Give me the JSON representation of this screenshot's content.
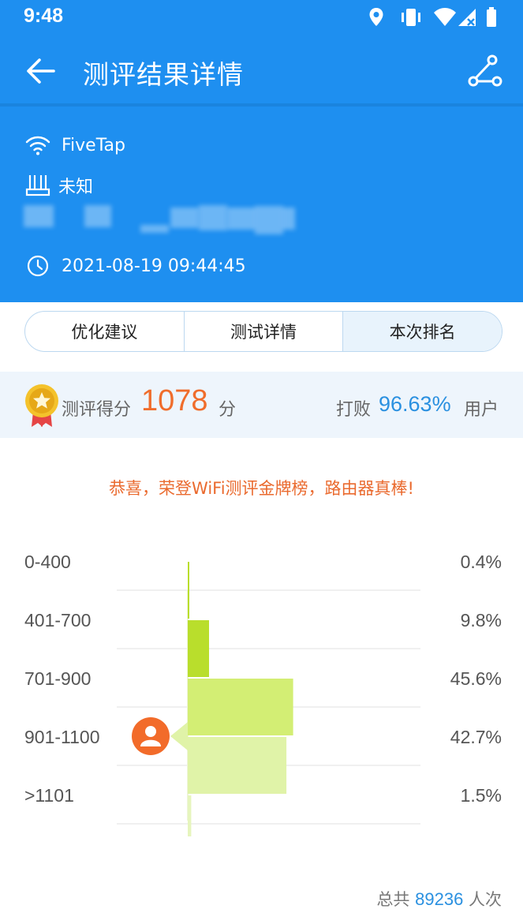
{
  "status_bar": {
    "time": "9:48",
    "icons": [
      "location-icon",
      "vibrate-icon",
      "wifi-icon",
      "signal-off-icon",
      "battery-icon"
    ]
  },
  "app_bar": {
    "title": "测评结果详情",
    "back_icon": "back-arrow-icon",
    "share_icon": "share-icon"
  },
  "network": {
    "ssid": "FiveTap",
    "router": "未知",
    "test_time": "2021-08-19 09:44:45"
  },
  "tabs": [
    {
      "label": "优化建议",
      "active": false
    },
    {
      "label": "测试详情",
      "active": false
    },
    {
      "label": "本次排名",
      "active": true
    }
  ],
  "score": {
    "label": "测评得分",
    "value": "1078",
    "unit": "分",
    "beat_label": "打败",
    "beat_value": "96.63%",
    "beat_unit": "用户"
  },
  "congrats": "恭喜，荣登WiFi测评金牌榜，路由器真棒!",
  "chart_data": {
    "type": "bar",
    "orientation": "horizontal",
    "categories": [
      "0-400",
      "401-700",
      "701-900",
      "901-1100",
      ">1101"
    ],
    "values": [
      0.4,
      9.8,
      45.6,
      42.7,
      1.5
    ],
    "value_labels": [
      "0.4%",
      "9.8%",
      "45.6%",
      "42.7%",
      "1.5%"
    ],
    "user_bucket": "901-1100",
    "colors": [
      "#b9de2c",
      "#b9de2c",
      "#d3ee74",
      "#e0f3a8",
      "#e6f5bd"
    ]
  },
  "footer": {
    "total_prefix": "总共",
    "total_count": "89236",
    "total_suffix": "人次"
  },
  "colors": {
    "primary_blue": "#1e8ff0",
    "score_orange": "#f06d2c",
    "percent_blue": "#2a90e0",
    "user_marker": "#f26b2a"
  }
}
